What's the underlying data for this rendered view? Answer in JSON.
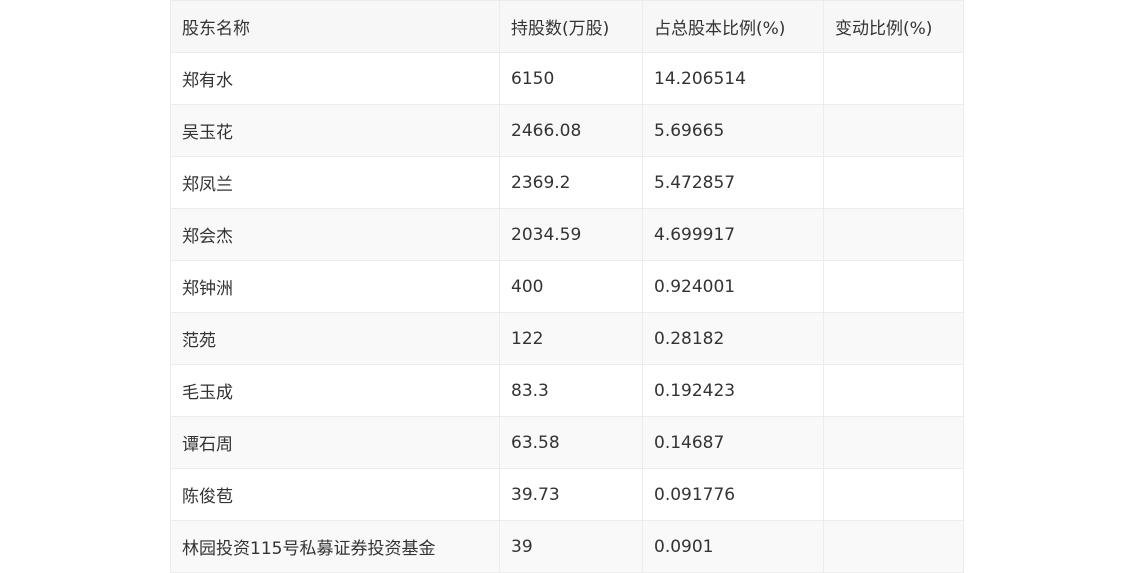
{
  "table": {
    "headers": [
      "股东名称",
      "持股数(万股)",
      "占总股本比例(%)",
      "变动比例(%)"
    ],
    "rows": [
      [
        "郑有水",
        "6150",
        "14.206514",
        ""
      ],
      [
        "吴玉花",
        "2466.08",
        "5.69665",
        ""
      ],
      [
        "郑凤兰",
        "2369.2",
        "5.472857",
        ""
      ],
      [
        "郑会杰",
        "2034.59",
        "4.699917",
        ""
      ],
      [
        "郑钟洲",
        "400",
        "0.924001",
        ""
      ],
      [
        "范苑",
        "122",
        "0.28182",
        ""
      ],
      [
        "毛玉成",
        "83.3",
        "0.192423",
        ""
      ],
      [
        "谭石周",
        "63.58",
        "0.14687",
        ""
      ],
      [
        "陈俊苞",
        "39.73",
        "0.091776",
        ""
      ],
      [
        "林园投资115号私募证券投资基金",
        "39",
        "0.0901",
        ""
      ]
    ]
  }
}
